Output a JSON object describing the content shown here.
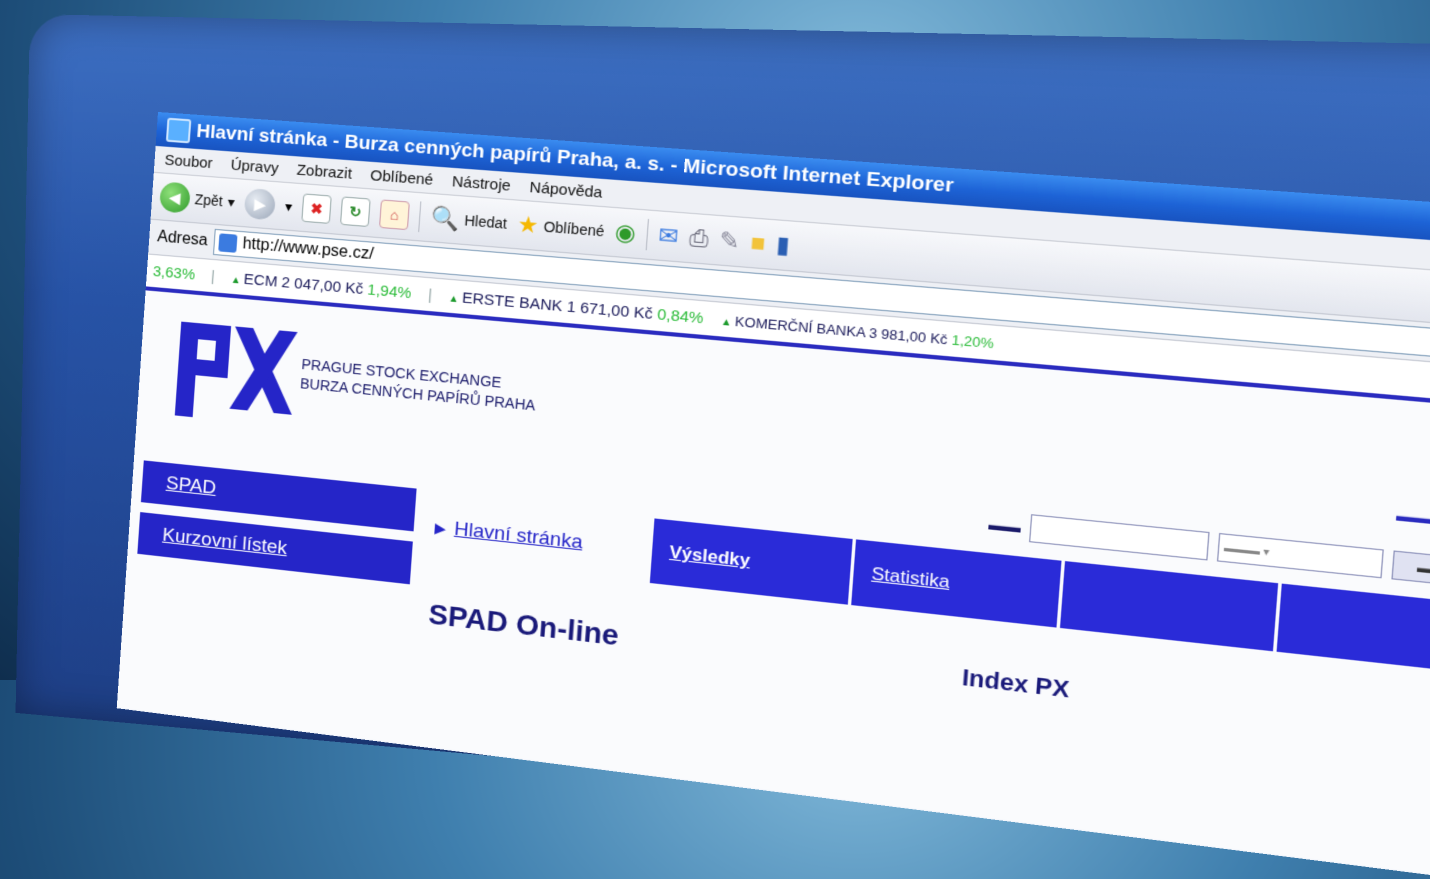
{
  "window": {
    "title": "Hlavní stránka - Burza cenných papírů Praha, a. s. - Microsoft Internet Explorer"
  },
  "menu": [
    "Soubor",
    "Úpravy",
    "Zobrazit",
    "Oblíbené",
    "Nástroje",
    "Nápověda"
  ],
  "toolbar": {
    "back_label": "Zpět",
    "search_label": "Hledat",
    "favorites_label": "Oblíbené"
  },
  "address": {
    "label": "Adresa",
    "url": "http://www.pse.cz/"
  },
  "ticker": [
    {
      "text": "3,63%",
      "pct": ""
    },
    {
      "text": "ECM 2 047,00 Kč",
      "pct": "1,94%"
    },
    {
      "text": "ERSTE BANK 1 671,00 Kč",
      "pct": "0,84%"
    },
    {
      "text": "KOMERČNÍ BANKA 3 981,00 Kč",
      "pct": "1,20%"
    }
  ],
  "brand": {
    "line1": "PRAGUE STOCK EXCHANGE",
    "line2": "BURZA CENNÝCH PAPÍRŮ PRAHA"
  },
  "nav": [
    "SPAD",
    "Kurzovní lístek"
  ],
  "breadcrumb": "Hlavní stránka",
  "tabs": [
    "Výsledky",
    "Statistika"
  ],
  "headline": "SPAD On-line",
  "index_title": "Index PX",
  "colors": {
    "nav_blue": "#2525c8",
    "ie_titlebar": "#1d63d6",
    "ticker_green": "#2cbc3a"
  }
}
